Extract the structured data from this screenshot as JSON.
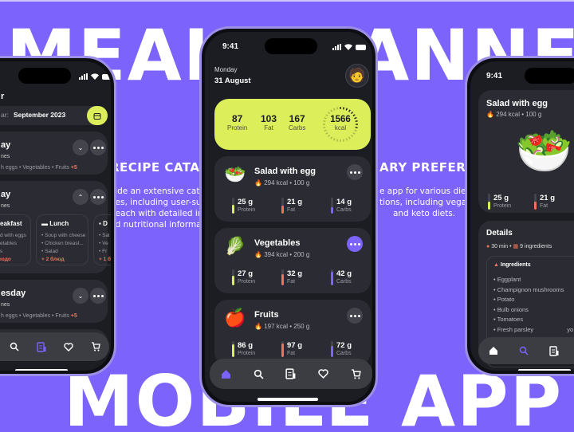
{
  "hero": {
    "title_top": "MEAL PLANNER",
    "title_bottom": "MOBILE APP"
  },
  "features": [
    {
      "heading": "RECIPE CATALOG",
      "lines": [
        "vide an extensive cata",
        "pes, including user-su",
        ", each with detailed in",
        "nd nutritional informa"
      ]
    },
    {
      "heading": "ARY PREFERE",
      "lines": [
        "e app for various dieta",
        "tions, including vegan",
        "and keto diets."
      ]
    }
  ],
  "center_phone": {
    "status_time": "9:41",
    "day": "Monday",
    "date": "31 August",
    "summary": {
      "protein_value": "87",
      "protein_label": "Protein",
      "fat_value": "103",
      "fat_label": "Fat",
      "carbs_value": "167",
      "carbs_label": "Carbs",
      "kcal_value": "1566",
      "kcal_label": "kcal",
      "kcal_progress": 0.3
    },
    "meals": [
      {
        "name": "Salad with egg",
        "icon": "🥗",
        "kcal": "294 kcal",
        "weight": "100 g",
        "macros": [
          {
            "value": "25 g",
            "label": "Protein",
            "color": "#dcef5a",
            "fill": 0.55
          },
          {
            "value": "21 g",
            "label": "Fat",
            "color": "#f07358",
            "fill": 0.5
          },
          {
            "value": "14 g",
            "label": "Carbs",
            "color": "#7b63fb",
            "fill": 0.4
          }
        ]
      },
      {
        "name": "Vegetables",
        "icon": "🥬",
        "kcal": "394 kcal",
        "weight": "200 g",
        "macros": [
          {
            "value": "27 g",
            "label": "Protein",
            "color": "#dcef5a",
            "fill": 0.6
          },
          {
            "value": "32 g",
            "label": "Fat",
            "color": "#f07358",
            "fill": 0.7
          },
          {
            "value": "42 g",
            "label": "Carbs",
            "color": "#7b63fb",
            "fill": 0.85
          }
        ]
      },
      {
        "name": "Fruits",
        "icon": "🍎",
        "kcal": "197 kcal",
        "weight": "250 g",
        "macros": [
          {
            "value": "86 g",
            "label": "Protein",
            "color": "#dcef5a",
            "fill": 0.8
          },
          {
            "value": "97 g",
            "label": "Fat",
            "color": "#f07358",
            "fill": 0.85
          },
          {
            "value": "72 g",
            "label": "Carbs",
            "color": "#7b63fb",
            "fill": 0.7
          }
        ]
      }
    ],
    "active_nav": "home"
  },
  "left_phone": {
    "header_partial": "r",
    "calendar_label": "ar:",
    "calendar_value": "September 2023",
    "days": [
      {
        "name": "ay",
        "sub": "nes",
        "items": "h eggs • Vegetables • Fruits",
        "more": "+5",
        "expanded": false
      },
      {
        "name": "ay",
        "sub": "nes",
        "expanded": true
      },
      {
        "name": "esday",
        "sub": "nes",
        "items": "h eggs • Vegetables • Fruits",
        "more": "+5",
        "expanded": false
      }
    ],
    "meal_columns": [
      {
        "title": "eakfast",
        "items": [
          "d with eggs",
          "etables",
          "s"
        ],
        "more": "ıодо"
      },
      {
        "title": "Lunch",
        "items": [
          "Soup with cheese",
          "Chicken breast...",
          "Salad"
        ],
        "more": "+ 2 блюд"
      },
      {
        "title": "D",
        "items": [
          "Sal",
          "Ve",
          "Fr"
        ],
        "more": "+ 1 б"
      }
    ],
    "active_nav": "recipes"
  },
  "right_phone": {
    "status_time": "9:41",
    "title": "Salad with egg",
    "kcal": "294 kcal",
    "weight": "100 g",
    "macros": [
      {
        "value": "25 g",
        "label": "Protein",
        "color": "#dcef5a"
      },
      {
        "value": "21 g",
        "label": "Fat",
        "color": "#f07358"
      }
    ],
    "details_title": "Details",
    "time": "30 min",
    "ingredients_count": "9 ingredients",
    "ingredients_header": "Ingredients",
    "ingredients": [
      "Eggplant",
      "Champignon mushrooms",
      "Potato",
      "Bulb onions",
      "Tomatoes",
      "Fresh parsley"
    ],
    "side_text": "yo",
    "active_nav": "search"
  }
}
